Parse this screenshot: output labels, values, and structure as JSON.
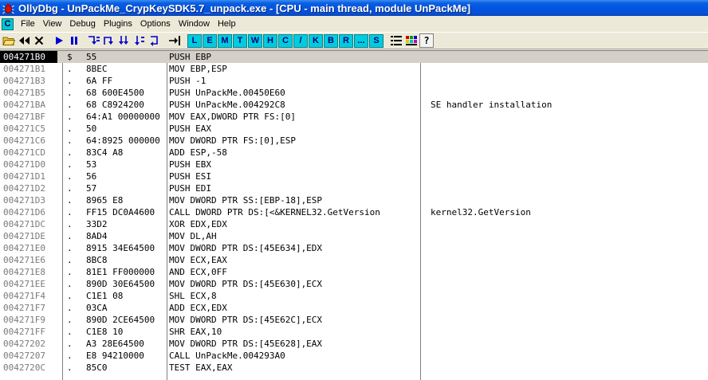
{
  "window": {
    "title": "OllyDbg - UnPackMe_CrypKeySDK5.7_unpack.exe - [CPU - main thread, module UnPackMe]"
  },
  "menubar": {
    "c_label": "C",
    "items": [
      "File",
      "View",
      "Debug",
      "Plugins",
      "Options",
      "Window",
      "Help"
    ]
  },
  "toolbar": {
    "letters": [
      "L",
      "E",
      "M",
      "T",
      "W",
      "H",
      "C",
      "/",
      "K",
      "B",
      "R",
      "...",
      "S"
    ],
    "help_label": "?"
  },
  "colors": {
    "titlebar_blue": "#0054e3",
    "letter_button_cyan": "#00ccdd",
    "address_gray": "#7a7a7a",
    "selected_address_bg": "#000000"
  },
  "disassembly": {
    "rows": [
      {
        "addr": "004271B0",
        "marker": "$",
        "hex": "55",
        "disasm": "PUSH EBP",
        "comment": "",
        "selected": true
      },
      {
        "addr": "004271B1",
        "marker": ".",
        "hex": "8BEC",
        "disasm": "MOV EBP,ESP",
        "comment": ""
      },
      {
        "addr": "004271B3",
        "marker": ".",
        "hex": "6A FF",
        "disasm": "PUSH -1",
        "comment": ""
      },
      {
        "addr": "004271B5",
        "marker": ".",
        "hex": "68 600E4500",
        "disasm": "PUSH UnPackMe.00450E60",
        "comment": ""
      },
      {
        "addr": "004271BA",
        "marker": ".",
        "hex": "68 C8924200",
        "disasm": "PUSH UnPackMe.004292C8",
        "comment": "SE handler installation"
      },
      {
        "addr": "004271BF",
        "marker": ".",
        "hex": "64:A1 00000000",
        "disasm": "MOV EAX,DWORD PTR FS:[0]",
        "comment": ""
      },
      {
        "addr": "004271C5",
        "marker": ".",
        "hex": "50",
        "disasm": "PUSH EAX",
        "comment": ""
      },
      {
        "addr": "004271C6",
        "marker": ".",
        "hex": "64:8925 000000",
        "disasm": "MOV DWORD PTR FS:[0],ESP",
        "comment": ""
      },
      {
        "addr": "004271CD",
        "marker": ".",
        "hex": "83C4 A8",
        "disasm": "ADD ESP,-58",
        "comment": ""
      },
      {
        "addr": "004271D0",
        "marker": ".",
        "hex": "53",
        "disasm": "PUSH EBX",
        "comment": ""
      },
      {
        "addr": "004271D1",
        "marker": ".",
        "hex": "56",
        "disasm": "PUSH ESI",
        "comment": ""
      },
      {
        "addr": "004271D2",
        "marker": ".",
        "hex": "57",
        "disasm": "PUSH EDI",
        "comment": ""
      },
      {
        "addr": "004271D3",
        "marker": ".",
        "hex": "8965 E8",
        "disasm": "MOV DWORD PTR SS:[EBP-18],ESP",
        "comment": ""
      },
      {
        "addr": "004271D6",
        "marker": ".",
        "hex": "FF15 DC0A4600",
        "disasm": "CALL DWORD PTR DS:[<&KERNEL32.GetVersion",
        "comment": "kernel32.GetVersion"
      },
      {
        "addr": "004271DC",
        "marker": ".",
        "hex": "33D2",
        "disasm": "XOR EDX,EDX",
        "comment": ""
      },
      {
        "addr": "004271DE",
        "marker": ".",
        "hex": "8AD4",
        "disasm": "MOV DL,AH",
        "comment": ""
      },
      {
        "addr": "004271E0",
        "marker": ".",
        "hex": "8915 34E64500",
        "disasm": "MOV DWORD PTR DS:[45E634],EDX",
        "comment": ""
      },
      {
        "addr": "004271E6",
        "marker": ".",
        "hex": "8BC8",
        "disasm": "MOV ECX,EAX",
        "comment": ""
      },
      {
        "addr": "004271E8",
        "marker": ".",
        "hex": "81E1 FF000000",
        "disasm": "AND ECX,0FF",
        "comment": ""
      },
      {
        "addr": "004271EE",
        "marker": ".",
        "hex": "890D 30E64500",
        "disasm": "MOV DWORD PTR DS:[45E630],ECX",
        "comment": ""
      },
      {
        "addr": "004271F4",
        "marker": ".",
        "hex": "C1E1 08",
        "disasm": "SHL ECX,8",
        "comment": ""
      },
      {
        "addr": "004271F7",
        "marker": ".",
        "hex": "03CA",
        "disasm": "ADD ECX,EDX",
        "comment": ""
      },
      {
        "addr": "004271F9",
        "marker": ".",
        "hex": "890D 2CE64500",
        "disasm": "MOV DWORD PTR DS:[45E62C],ECX",
        "comment": ""
      },
      {
        "addr": "004271FF",
        "marker": ".",
        "hex": "C1E8 10",
        "disasm": "SHR EAX,10",
        "comment": ""
      },
      {
        "addr": "00427202",
        "marker": ".",
        "hex": "A3 28E64500",
        "disasm": "MOV DWORD PTR DS:[45E628],EAX",
        "comment": ""
      },
      {
        "addr": "00427207",
        "marker": ".",
        "hex": "E8 94210000",
        "disasm": "CALL UnPackMe.004293A0",
        "comment": ""
      },
      {
        "addr": "0042720C",
        "marker": ".",
        "hex": "85C0",
        "disasm": "TEST EAX,EAX",
        "comment": ""
      }
    ]
  }
}
